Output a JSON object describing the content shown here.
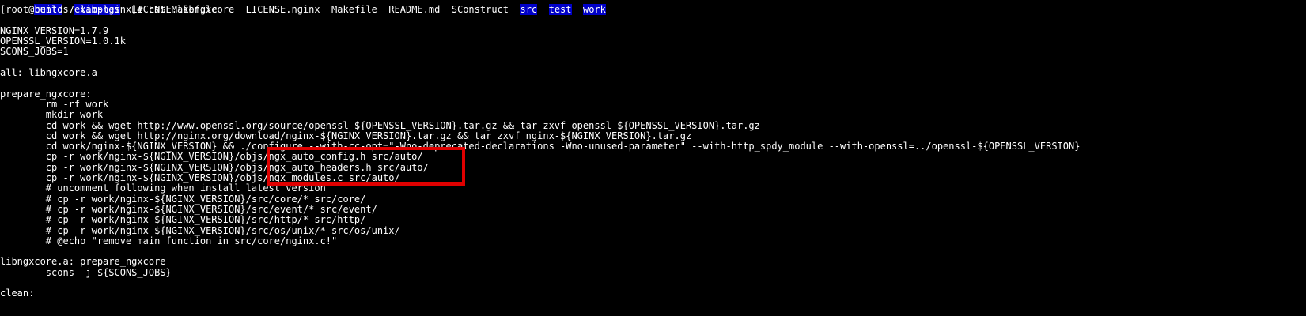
{
  "terminal": {
    "listing_line": {
      "segments": [
        {
          "text": "build",
          "type": "dir"
        },
        {
          "text": "  ",
          "type": "plain"
        },
        {
          "text": "examples",
          "type": "dir"
        },
        {
          "text": "  LICENSE.libngxcore  LICENSE.nginx  Makefile  README.md  SConstruct  ",
          "type": "plain"
        },
        {
          "text": "src",
          "type": "dir"
        },
        {
          "text": "  ",
          "type": "plain"
        },
        {
          "text": "test",
          "type": "dir"
        },
        {
          "text": "  ",
          "type": "plain"
        },
        {
          "text": "work",
          "type": "dir"
        }
      ]
    },
    "lines": [
      "[root@centos7 lib-nginx]# cat Makefile",
      "",
      "NGINX_VERSION=1.7.9",
      "OPENSSL_VERSION=1.0.1k",
      "SCONS_JOBS=1",
      "",
      "all: libngxcore.a",
      "",
      "prepare_ngxcore:",
      "        rm -rf work",
      "        mkdir work",
      "        cd work && wget http://www.openssl.org/source/openssl-${OPENSSL_VERSION}.tar.gz && tar zxvf openssl-${OPENSSL_VERSION}.tar.gz",
      "        cd work && wget http://nginx.org/download/nginx-${NGINX_VERSION}.tar.gz && tar zxvf nginx-${NGINX_VERSION}.tar.gz",
      "        cd work/nginx-${NGINX_VERSION} && ./configure --with-cc-opt=\"-Wno-deprecated-declarations -Wno-unused-parameter\" --with-http_spdy_module --with-openssl=../openssl-${OPENSSL_VERSION}",
      "        cp -r work/nginx-${NGINX_VERSION}/objs/ngx_auto_config.h src/auto/",
      "        cp -r work/nginx-${NGINX_VERSION}/objs/ngx_auto_headers.h src/auto/",
      "        cp -r work/nginx-${NGINX_VERSION}/objs/ngx_modules.c src/auto/",
      "        # uncomment following when install latest version",
      "        # cp -r work/nginx-${NGINX_VERSION}/src/core/* src/core/",
      "        # cp -r work/nginx-${NGINX_VERSION}/src/event/* src/event/",
      "        # cp -r work/nginx-${NGINX_VERSION}/src/http/* src/http/",
      "        # cp -r work/nginx-${NGINX_VERSION}/src/os/unix/* src/os/unix/",
      "        # @echo \"remove main function in src/core/nginx.c!\"",
      "",
      "libngxcore.a: prepare_ngxcore",
      "        scons -j ${SCONS_JOBS}",
      "",
      "clean:"
    ]
  },
  "colors": {
    "background": "#000000",
    "text": "#ffffff",
    "dir_highlight": "#0000c8",
    "annotation_box": "#e00000"
  }
}
